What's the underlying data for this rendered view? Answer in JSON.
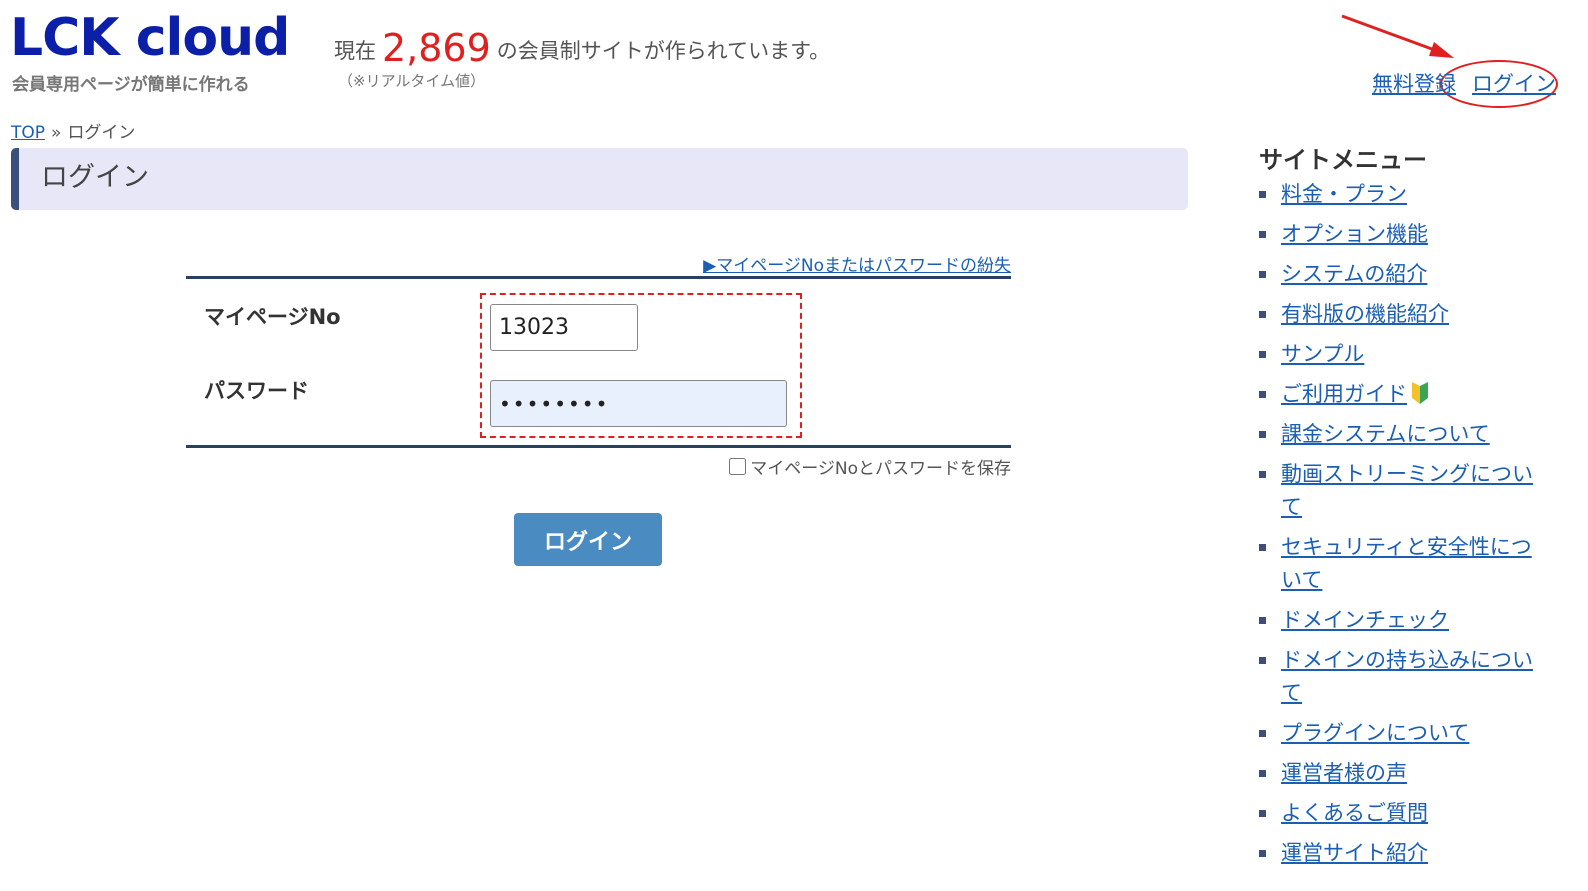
{
  "header": {
    "logo": "LCK cloud",
    "logo_sub": "会員専用ページが簡単に作れる",
    "counter_prefix": "現在",
    "counter_value": "2,869",
    "counter_suffix": "の会員制サイトが作られています。",
    "counter_note": "（※リアルタイム値）",
    "register_link": "無料登録",
    "login_link": "ログイン"
  },
  "breadcrumb": {
    "top": "TOP",
    "sep": "»",
    "current": "ログイン"
  },
  "page_title": "ログイン",
  "form": {
    "lost_link": "▶マイページNoまたはパスワードの紛失",
    "mypage_label": "マイページNo",
    "mypage_value": "13023",
    "password_label": "パスワード",
    "password_value": "••••••••",
    "save_label": "マイページNoとパスワードを保存",
    "save_checked": false,
    "submit_label": "ログイン"
  },
  "side": {
    "title": "サイトメニュー",
    "items": [
      "料金・プラン",
      "オプション機能",
      "システムの紹介",
      "有料版の機能紹介",
      "サンプル",
      "ご利用ガイド",
      "課金システムについて",
      "動画ストリーミングについて",
      "セキュリティと安全性について",
      "ドメインチェック",
      "ドメインの持ち込みについて",
      "プラグインについて",
      "運営者様の声",
      "よくあるご質問",
      "運営サイト紹介"
    ]
  },
  "colors": {
    "accent_red": "#e0201f",
    "logo_blue": "#0c1fa8",
    "button_blue": "#4a8cc2",
    "link_blue": "#1a5fb4"
  },
  "icons": [
    "beginner-mark-icon",
    "arrow-annotation-icon"
  ]
}
